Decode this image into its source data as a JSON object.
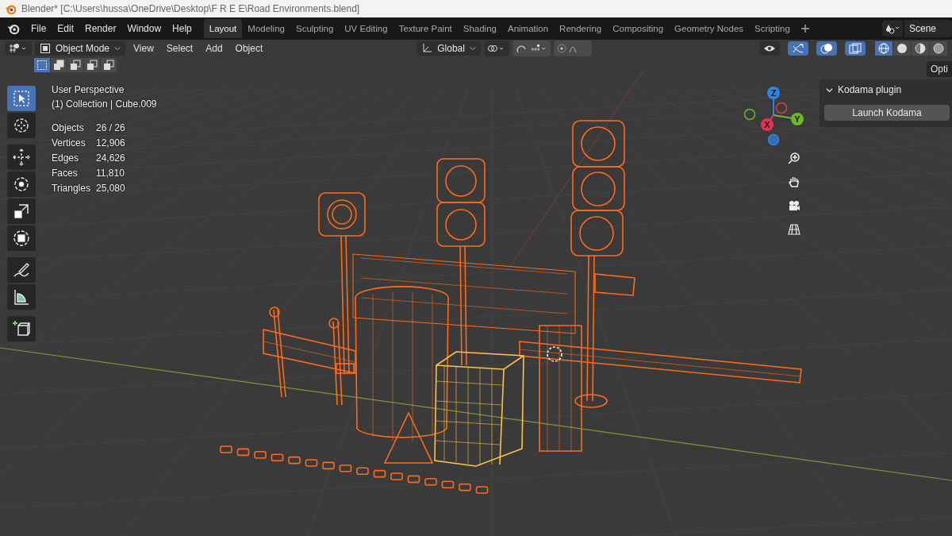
{
  "window": {
    "title": "Blender* [C:\\Users\\hussa\\OneDrive\\Desktop\\F R E E\\Road Environments.blend]"
  },
  "menu": [
    "File",
    "Edit",
    "Render",
    "Window",
    "Help"
  ],
  "workspaces": [
    {
      "label": "Layout",
      "selected": true
    },
    {
      "label": "Modeling",
      "selected": false
    },
    {
      "label": "Sculpting",
      "selected": false
    },
    {
      "label": "UV Editing",
      "selected": false
    },
    {
      "label": "Texture Paint",
      "selected": false
    },
    {
      "label": "Shading",
      "selected": false
    },
    {
      "label": "Animation",
      "selected": false
    },
    {
      "label": "Rendering",
      "selected": false
    },
    {
      "label": "Compositing",
      "selected": false
    },
    {
      "label": "Geometry Nodes",
      "selected": false
    },
    {
      "label": "Scripting",
      "selected": false
    }
  ],
  "scene": "Scene",
  "header": {
    "mode": "Object Mode",
    "menus": [
      "View",
      "Select",
      "Add",
      "Object"
    ],
    "orientation": "Global",
    "select_modes": [
      {
        "selected": true
      },
      {
        "selected": false
      },
      {
        "selected": false
      },
      {
        "selected": false
      },
      {
        "selected": false
      }
    ],
    "toggles": [
      {
        "kind": "visibility",
        "on": false
      },
      {
        "kind": "gizmo",
        "on": true
      },
      {
        "kind": "overlay",
        "on": true
      },
      {
        "kind": "xray",
        "on": true
      }
    ],
    "shading": [
      {
        "kind": "wireframe",
        "selected": true
      },
      {
        "kind": "solid",
        "selected": false
      },
      {
        "kind": "material",
        "selected": false
      },
      {
        "kind": "rendered",
        "selected": false
      }
    ]
  },
  "toolbar": [
    {
      "kind": "select",
      "selected": true
    },
    {
      "kind": "cursor",
      "selected": false
    },
    {
      "kind": "move",
      "selected": false
    },
    {
      "kind": "rotate",
      "selected": false
    },
    {
      "kind": "scale",
      "selected": false
    },
    {
      "kind": "transform",
      "selected": false
    },
    {
      "kind": "annotate",
      "selected": false
    },
    {
      "kind": "measure",
      "selected": false
    },
    {
      "kind": "add-cube",
      "selected": false
    }
  ],
  "viewport": {
    "view_name": "User Perspective",
    "collection": "(1) Collection | Cube.009",
    "stats": [
      {
        "label": "Objects",
        "value": "26 / 26"
      },
      {
        "label": "Vertices",
        "value": "12,906"
      },
      {
        "label": "Edges",
        "value": "24,626"
      },
      {
        "label": "Faces",
        "value": "11,810"
      },
      {
        "label": "Triangles",
        "value": "25,080"
      }
    ],
    "gizmo_axes": [
      {
        "label": "Z",
        "color": "#2f83e3"
      },
      {
        "label": "Y",
        "color": "#6fb72a"
      },
      {
        "label": "X",
        "color": "#e5334e"
      }
    ]
  },
  "sidebar": {
    "tab": "Opti",
    "panel": {
      "title": "Kodama plugin",
      "expanded": true,
      "button": "Launch Kodama"
    }
  }
}
